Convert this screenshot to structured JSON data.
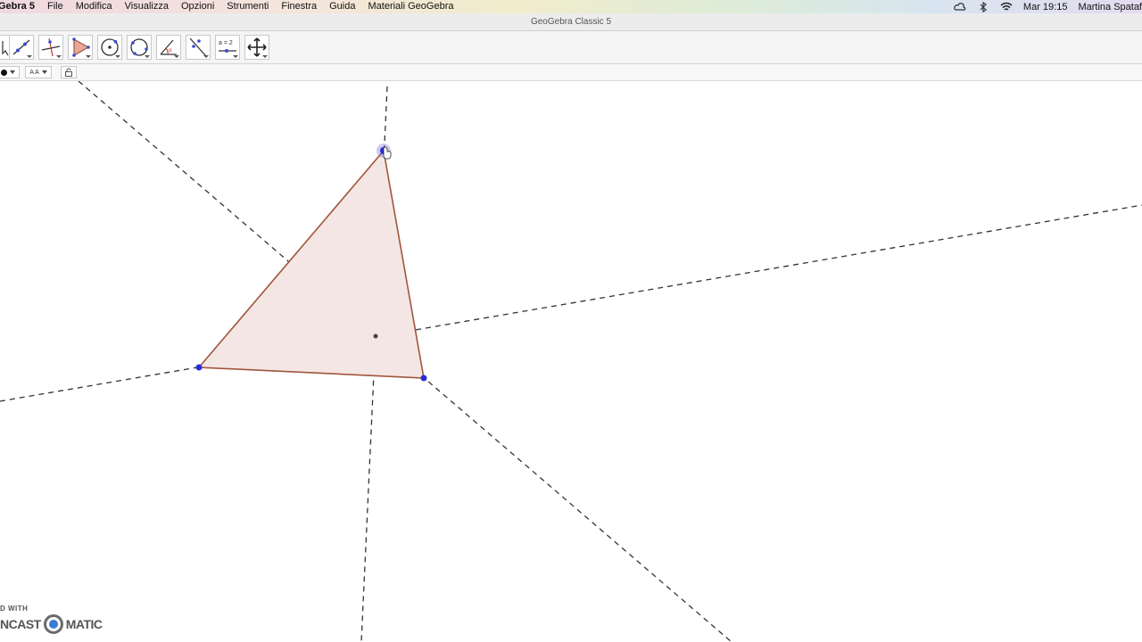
{
  "menubar": {
    "app_name": "Gebra 5",
    "items": [
      "File",
      "Modifica",
      "Visualizza",
      "Opzioni",
      "Strumenti",
      "Finestra",
      "Guida",
      "Materiali GeoGebra"
    ],
    "status_icons": [
      "creative-cloud-icon",
      "bluetooth-icon",
      "wifi-icon"
    ],
    "clock": "Mar 19:15",
    "user": "Martina Spataf"
  },
  "window": {
    "title": "GeoGebra Classic 5"
  },
  "toolbar": {
    "tools": [
      {
        "name": "move-tool",
        "icon": "arrow-icon"
      },
      {
        "name": "line-tool",
        "icon": "line-icon"
      },
      {
        "name": "perpendicular-line-tool",
        "icon": "perpendicular-icon"
      },
      {
        "name": "polygon-tool",
        "icon": "polygon-icon"
      },
      {
        "name": "circle-center-point-tool",
        "icon": "circle-icon"
      },
      {
        "name": "circle-three-points-tool",
        "icon": "circle-three-points-icon"
      },
      {
        "name": "angle-tool",
        "icon": "angle-icon"
      },
      {
        "name": "reflect-tool",
        "icon": "reflect-icon"
      },
      {
        "name": "slider-tool",
        "icon": "slider-icon",
        "label": "a = 2"
      },
      {
        "name": "move-graphics-view-tool",
        "icon": "move-view-icon"
      }
    ]
  },
  "stylebar": {
    "point_style": "point-style-icon",
    "text_size_label": "A A",
    "lock_icon": "lock-icon"
  },
  "watermark": {
    "top": "D WITH",
    "left": "NCAST",
    "right": "MATIC"
  },
  "colors": {
    "triangle_fill": "#f4e6e4",
    "triangle_stroke": "#a0553c",
    "point": "#2c2cd4",
    "dashed_line": "#333333"
  }
}
